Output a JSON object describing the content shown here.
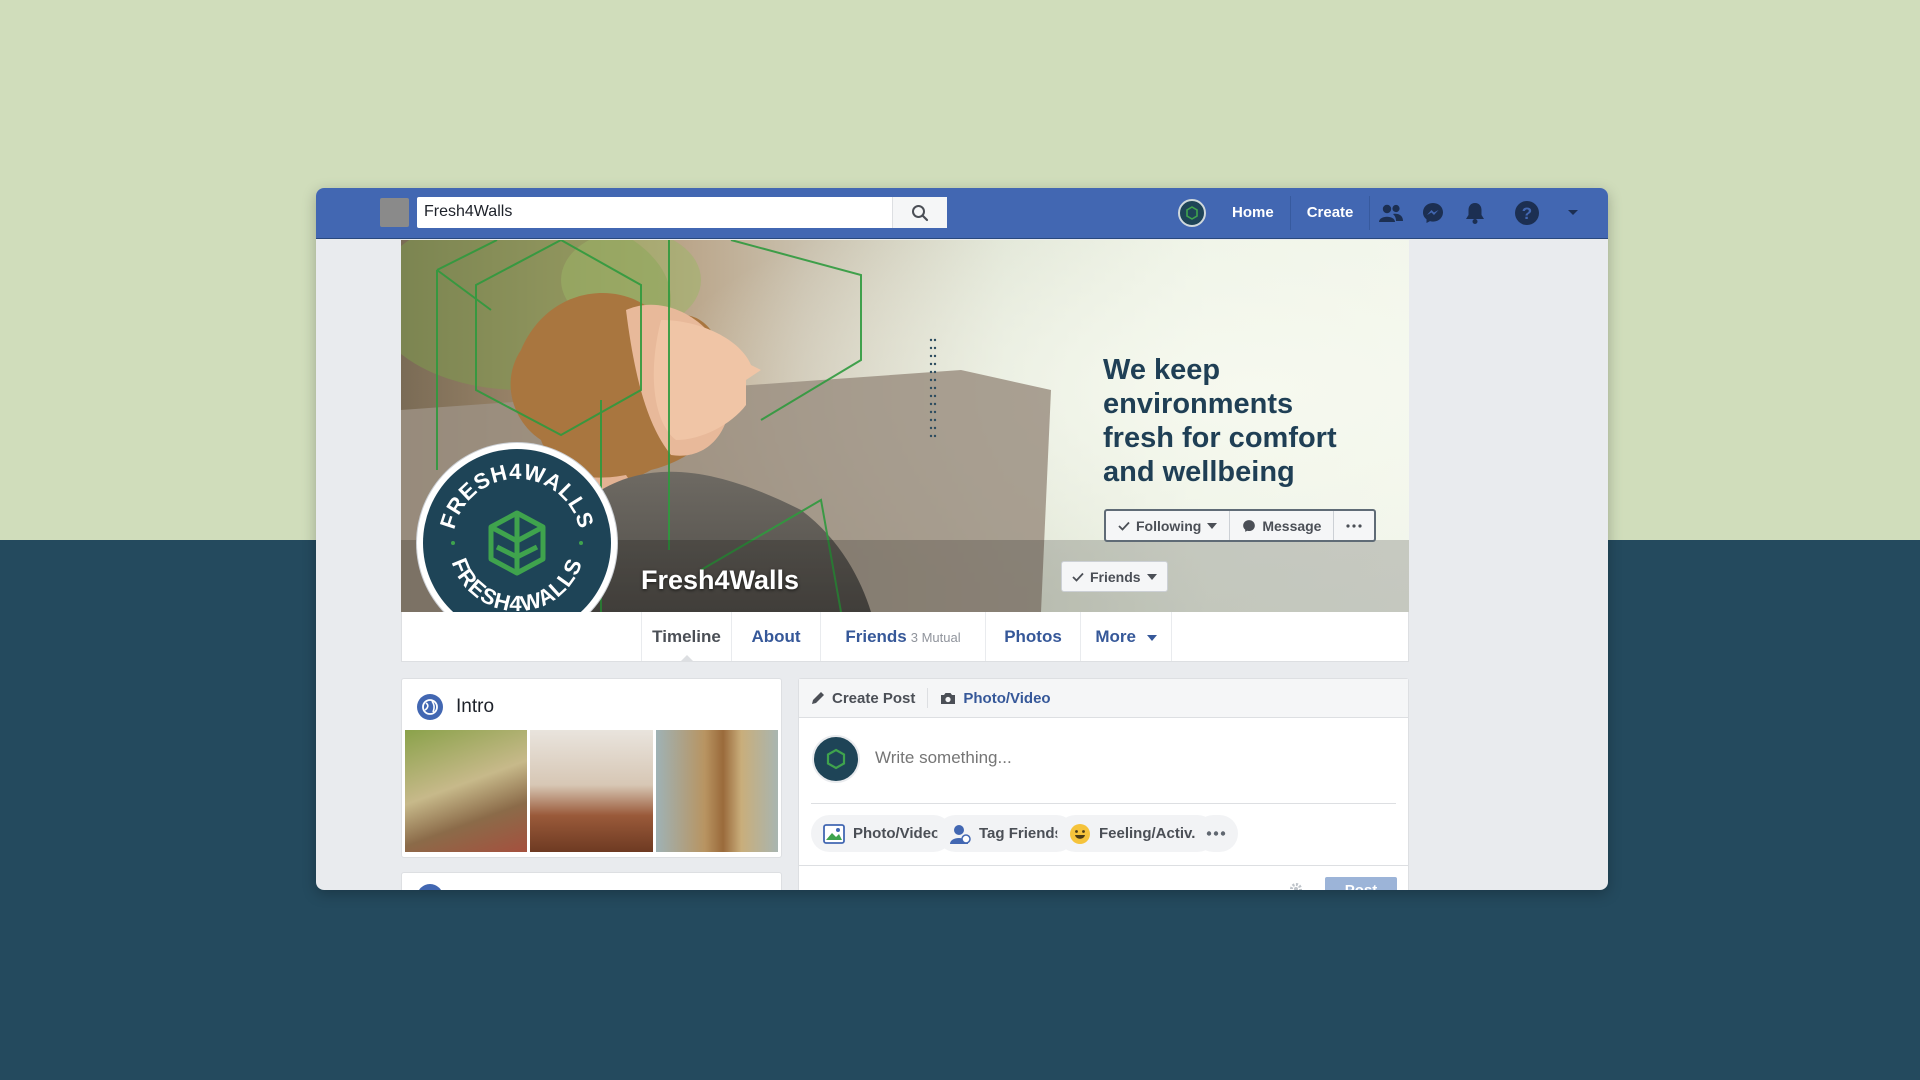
{
  "search": {
    "value": "Fresh4Walls"
  },
  "nav": {
    "home": "Home",
    "create": "Create"
  },
  "cover": {
    "tagline": "We keep environments fresh for comfort and wellbeing",
    "page_name": "Fresh4Walls"
  },
  "logo": {
    "text": "FRESH4WALLS"
  },
  "actions": {
    "friends": "Friends",
    "following": "Following",
    "message": "Message"
  },
  "tabs": {
    "timeline": "Timeline",
    "about": "About",
    "friends": "Friends",
    "friends_mutual": "3 Mutual",
    "photos": "Photos",
    "more": "More"
  },
  "intro": {
    "title": "Intro"
  },
  "composer": {
    "create_post": "Create Post",
    "photo_video_tab": "Photo/Video",
    "placeholder": "Write something...",
    "photo_video": "Photo/Video",
    "tag_friends": "Tag Friends",
    "feeling": "Feeling/Activ...",
    "post": "Post"
  },
  "colors": {
    "facebook_blue": "#4267b2",
    "brand_navy": "#1e4457",
    "brand_green": "#3fa34d",
    "bg_top": "#d0ddbb",
    "bg_bottom": "#244a5e"
  }
}
